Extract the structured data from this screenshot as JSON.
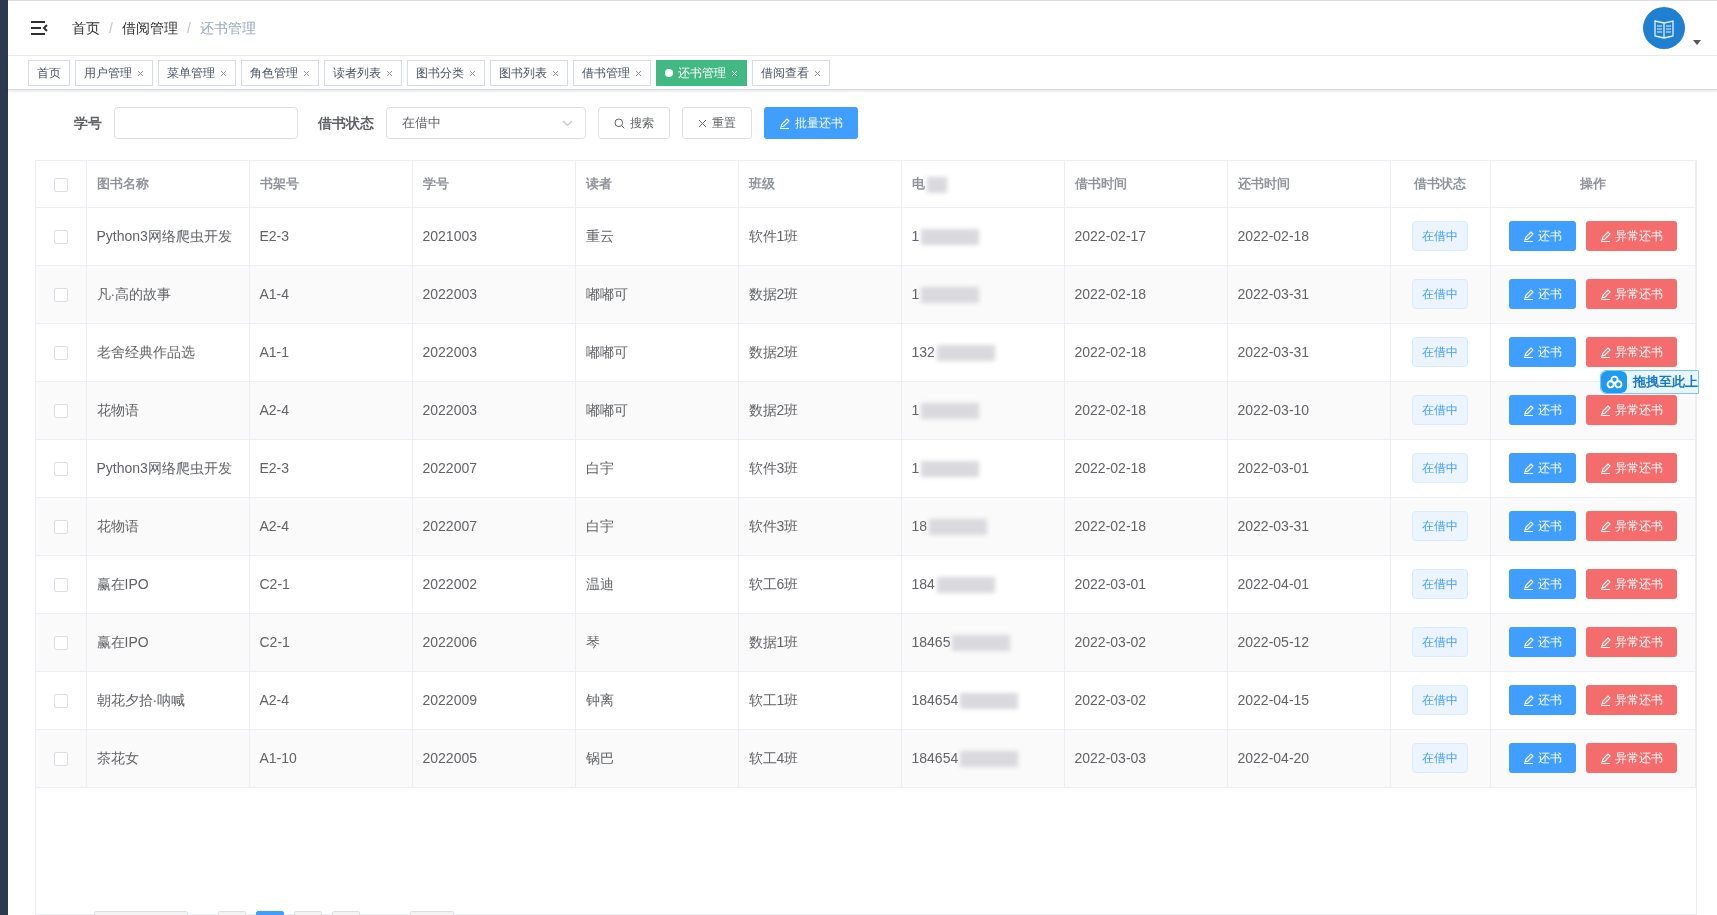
{
  "breadcrumb": [
    "首页",
    "借阅管理",
    "还书管理"
  ],
  "breadcrumb_separator": "/",
  "tabs": [
    {
      "label": "首页",
      "closable": false,
      "selected": false
    },
    {
      "label": "用户管理",
      "closable": true,
      "selected": false
    },
    {
      "label": "菜单管理",
      "closable": true,
      "selected": false
    },
    {
      "label": "角色管理",
      "closable": true,
      "selected": false
    },
    {
      "label": "读者列表",
      "closable": true,
      "selected": false
    },
    {
      "label": "图书分类",
      "closable": true,
      "selected": false
    },
    {
      "label": "图书列表",
      "closable": true,
      "selected": false
    },
    {
      "label": "借书管理",
      "closable": true,
      "selected": false
    },
    {
      "label": "还书管理",
      "closable": true,
      "selected": true
    },
    {
      "label": "借阅查看",
      "closable": true,
      "selected": false
    }
  ],
  "filters": {
    "student_id_label": "学号",
    "status_label": "借书状态",
    "status_value": "在借中",
    "search_button": "搜索",
    "reset_button": "重置",
    "batch_button": "批量还书"
  },
  "table": {
    "select_all_checked": false,
    "columns": [
      "图书名称",
      "书架号",
      "学号",
      "读者",
      "班级",
      "电",
      "借书时间",
      "还书时间",
      "借书状态",
      "操作"
    ],
    "rows": [
      {
        "checked": false,
        "cells": [
          "Python3网络爬虫开发",
          "E2-3",
          "2021003",
          "重云",
          "软件1班",
          "1",
          "2022-02-17",
          "2022-02-18",
          "在借中"
        ],
        "actions": [
          "还书",
          "异常还书"
        ]
      },
      {
        "checked": false,
        "cells": [
          "凡·高的故事",
          "A1-4",
          "2022003",
          "嘟嘟可",
          "数据2班",
          "1",
          "2022-02-18",
          "2022-03-31",
          "在借中"
        ],
        "actions": [
          "还书",
          "异常还书"
        ]
      },
      {
        "checked": false,
        "cells": [
          "老舍经典作品选",
          "A1-1",
          "2022003",
          "嘟嘟可",
          "数据2班",
          "132",
          "2022-02-18",
          "2022-03-31",
          "在借中"
        ],
        "actions": [
          "还书",
          "异常还书"
        ]
      },
      {
        "checked": false,
        "cells": [
          "花物语",
          "A2-4",
          "2022003",
          "嘟嘟可",
          "数据2班",
          "1",
          "2022-02-18",
          "2022-03-10",
          "在借中"
        ],
        "actions": [
          "还书",
          "异常还书"
        ]
      },
      {
        "checked": false,
        "cells": [
          "Python3网络爬虫开发",
          "E2-3",
          "2022007",
          "白宇",
          "软件3班",
          "1",
          "2022-02-18",
          "2022-03-01",
          "在借中"
        ],
        "actions": [
          "还书",
          "异常还书"
        ]
      },
      {
        "checked": false,
        "cells": [
          "花物语",
          "A2-4",
          "2022007",
          "白宇",
          "软件3班",
          "18",
          "2022-02-18",
          "2022-03-31",
          "在借中"
        ],
        "actions": [
          "还书",
          "异常还书"
        ]
      },
      {
        "checked": false,
        "cells": [
          "赢在IPO",
          "C2-1",
          "2022002",
          "温迪",
          "软工6班",
          "184",
          "2022-03-01",
          "2022-04-01",
          "在借中"
        ],
        "actions": [
          "还书",
          "异常还书"
        ]
      },
      {
        "checked": false,
        "cells": [
          "赢在IPO",
          "C2-1",
          "2022006",
          "琴",
          "数据1班",
          "18465",
          "2022-03-02",
          "2022-05-12",
          "在借中"
        ],
        "actions": [
          "还书",
          "异常还书"
        ]
      },
      {
        "checked": false,
        "cells": [
          "朝花夕拾·呐喊",
          "A2-4",
          "2022009",
          "钟离",
          "软工1班",
          "184654",
          "2022-03-02",
          "2022-04-15",
          "在借中"
        ],
        "actions": [
          "还书",
          "异常还书"
        ]
      },
      {
        "checked": false,
        "cells": [
          "茶花女",
          "A1-10",
          "2022005",
          "锅巴",
          "软工4班",
          "184654",
          "2022-03-03",
          "2022-04-20",
          "在借中"
        ],
        "actions": [
          "还书",
          "异常还书"
        ]
      }
    ]
  },
  "upload_widget": {
    "label": "拖拽至此上"
  }
}
